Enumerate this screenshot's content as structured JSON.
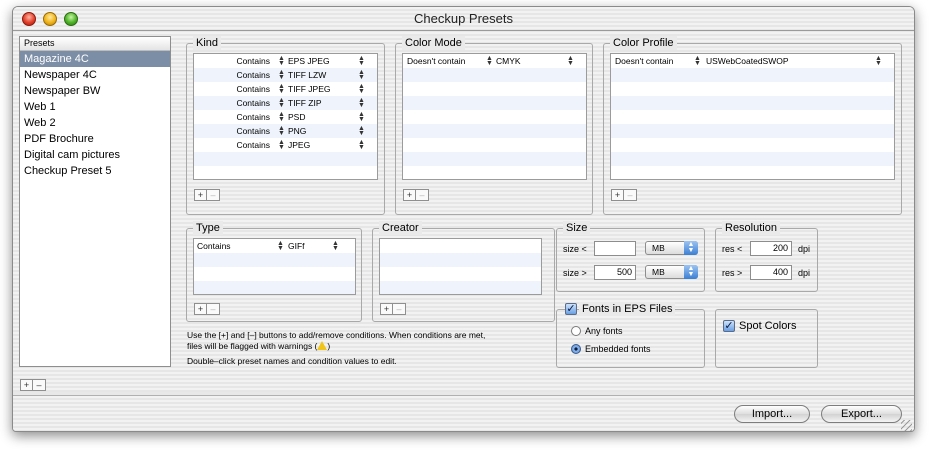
{
  "window": {
    "title": "Checkup Presets"
  },
  "presets": {
    "header": "Presets",
    "items": [
      "Magazine 4C",
      "Newspaper 4C",
      "Newspaper BW",
      "Web 1",
      "Web 2",
      "PDF Brochure",
      "Digital cam pictures",
      "Checkup Preset 5"
    ],
    "selected_index": 0
  },
  "add_label": "+",
  "remove_label": "–",
  "kind": {
    "title": "Kind",
    "rows": [
      {
        "op": "Contains",
        "value": "EPS JPEG"
      },
      {
        "op": "Contains",
        "value": "TIFF LZW"
      },
      {
        "op": "Contains",
        "value": "TIFF JPEG"
      },
      {
        "op": "Contains",
        "value": "TIFF ZIP"
      },
      {
        "op": "Contains",
        "value": "PSD"
      },
      {
        "op": "Contains",
        "value": "PNG"
      },
      {
        "op": "Contains",
        "value": "JPEG"
      }
    ]
  },
  "color_mode": {
    "title": "Color Mode",
    "rows": [
      {
        "op": "Doesn't contain",
        "value": "CMYK"
      }
    ]
  },
  "color_profile": {
    "title": "Color Profile",
    "rows": [
      {
        "op": "Doesn't contain",
        "value": "USWebCoatedSWOP"
      }
    ]
  },
  "type": {
    "title": "Type",
    "rows": [
      {
        "op": "Contains",
        "value": "GIFf"
      }
    ]
  },
  "creator": {
    "title": "Creator"
  },
  "help": {
    "line1": "Use the [+] and [–] buttons to add/remove conditions. When conditions are met,",
    "line2a": "files will be flagged with warnings (",
    "line2b": ")",
    "line3": "Double–click preset names and condition values to edit."
  },
  "size": {
    "title": "Size",
    "lt_label": "size <",
    "lt_value": "",
    "lt_unit": "MB",
    "gt_label": "size >",
    "gt_value": "500",
    "gt_unit": "MB"
  },
  "resolution": {
    "title": "Resolution",
    "lt_label": "res <",
    "lt_value": "200",
    "lt_unit": "dpi",
    "gt_label": "res >",
    "gt_value": "400",
    "gt_unit": "dpi"
  },
  "fonts": {
    "title": "Fonts in EPS Files",
    "checked": true,
    "option_any": "Any fonts",
    "option_embedded": "Embedded fonts",
    "selected": "embedded"
  },
  "spot": {
    "label": "Spot Colors",
    "checked": true
  },
  "buttons": {
    "import": "Import...",
    "export": "Export..."
  },
  "icons": {
    "up_down": "up-down-arrows-icon",
    "checkmark": "checkmark-icon",
    "warning": "warning-triangle-icon"
  }
}
